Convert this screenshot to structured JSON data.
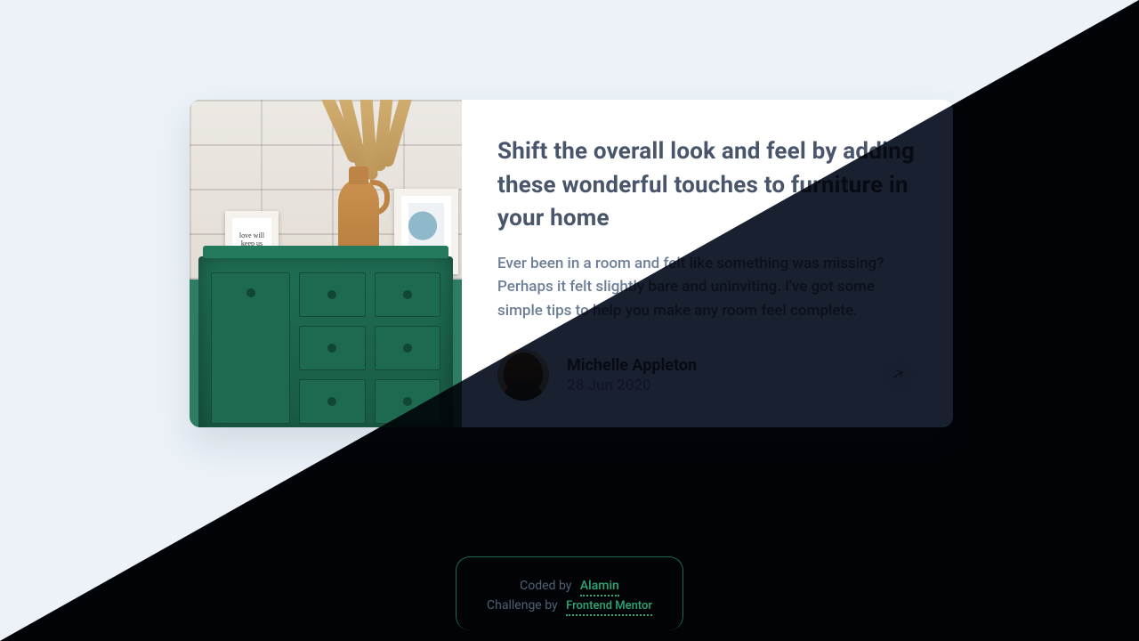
{
  "article": {
    "title": "Shift the overall look and feel by adding these wonderful touches to furniture in your home",
    "description": "Ever been in a room and felt like something was missing? Perhaps it felt slightly bare and uninviting. I've got some simple tips to help you make any room feel complete.",
    "author_name": "Michelle Appleton",
    "publish_date": "28 Jun 2020"
  },
  "attribution": {
    "coded_by_label": "Coded by",
    "coded_by_name": "Alamin",
    "challenge_by_label": "Challenge by",
    "challenge_by_name": "Frontend Mentor"
  }
}
